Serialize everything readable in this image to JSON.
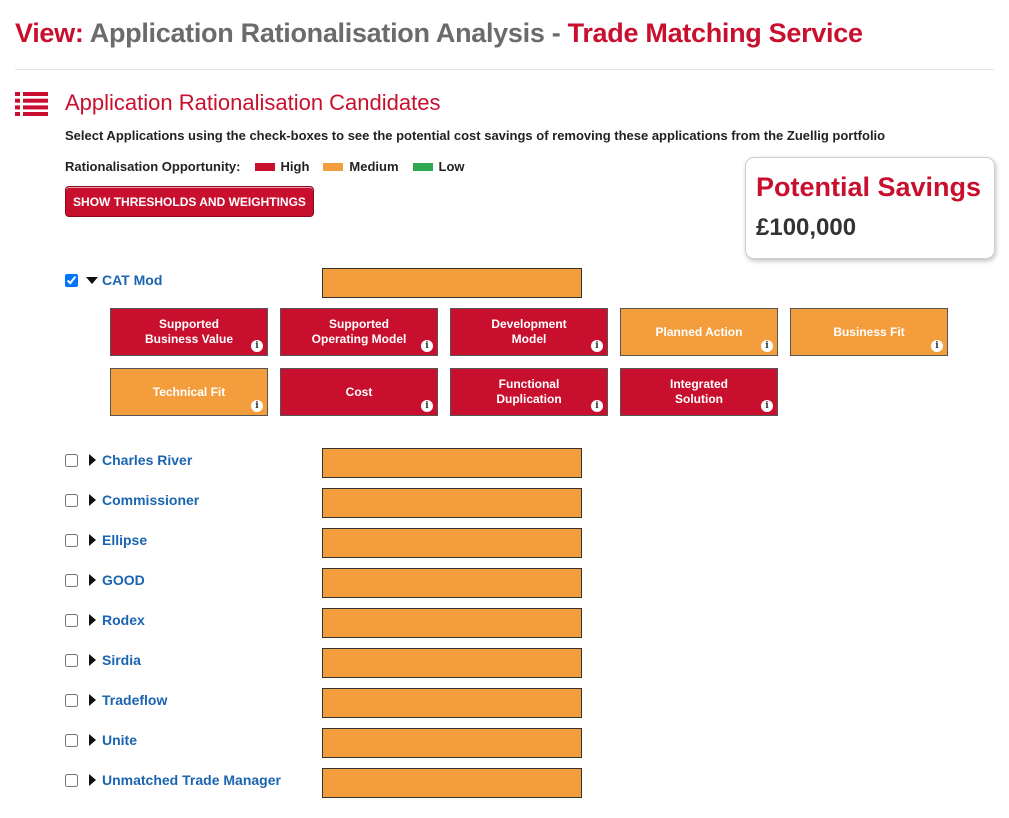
{
  "header": {
    "view_label": "View:",
    "analysis_name": "Application Rationalisation Analysis",
    "separator": "-",
    "subject": "Trade Matching Service"
  },
  "section": {
    "icon": "list-icon",
    "title": "Application Rationalisation Candidates",
    "instructions": "Select Applications using the check-boxes to see the potential cost savings of removing these applications from the Zuellig portfolio"
  },
  "legend": {
    "label": "Rationalisation Opportunity:",
    "items": [
      {
        "label": "High",
        "color": "#c8102e"
      },
      {
        "label": "Medium",
        "color": "#f49d3c"
      },
      {
        "label": "Low",
        "color": "#2fa84f"
      }
    ]
  },
  "thresholds_button": {
    "label": "SHOW THRESHOLDS AND WEIGHTINGS"
  },
  "savings": {
    "title": "Potential Savings",
    "value": "£100,000"
  },
  "colors": {
    "high": "#c8102e",
    "medium": "#f49d3c",
    "low": "#2fa84f",
    "link": "#1a64b0"
  },
  "applications": [
    {
      "name": "CAT Mod",
      "checked": true,
      "expanded": true,
      "rating": "medium"
    },
    {
      "name": "Charles River",
      "checked": false,
      "expanded": false,
      "rating": "medium"
    },
    {
      "name": "Commissioner",
      "checked": false,
      "expanded": false,
      "rating": "medium"
    },
    {
      "name": "Ellipse",
      "checked": false,
      "expanded": false,
      "rating": "medium"
    },
    {
      "name": "GOOD",
      "checked": false,
      "expanded": false,
      "rating": "medium"
    },
    {
      "name": "Rodex",
      "checked": false,
      "expanded": false,
      "rating": "medium"
    },
    {
      "name": "Sirdia",
      "checked": false,
      "expanded": false,
      "rating": "medium"
    },
    {
      "name": "Tradeflow",
      "checked": false,
      "expanded": false,
      "rating": "medium"
    },
    {
      "name": "Unite",
      "checked": false,
      "expanded": false,
      "rating": "medium"
    },
    {
      "name": "Unmatched Trade Manager",
      "checked": false,
      "expanded": false,
      "rating": "medium"
    }
  ],
  "criteria": [
    {
      "label": "Supported\nBusiness Value",
      "rating": "high"
    },
    {
      "label": "Supported\nOperating Model",
      "rating": "high"
    },
    {
      "label": "Development\nModel",
      "rating": "high"
    },
    {
      "label": "Planned Action",
      "rating": "medium"
    },
    {
      "label": "Business Fit",
      "rating": "medium"
    },
    {
      "label": "Technical Fit",
      "rating": "medium"
    },
    {
      "label": "Cost",
      "rating": "high"
    },
    {
      "label": "Functional\nDuplication",
      "rating": "high"
    },
    {
      "label": "Integrated\nSolution",
      "rating": "high"
    }
  ],
  "info_icon": {
    "name": "info-icon",
    "glyph": "i"
  }
}
